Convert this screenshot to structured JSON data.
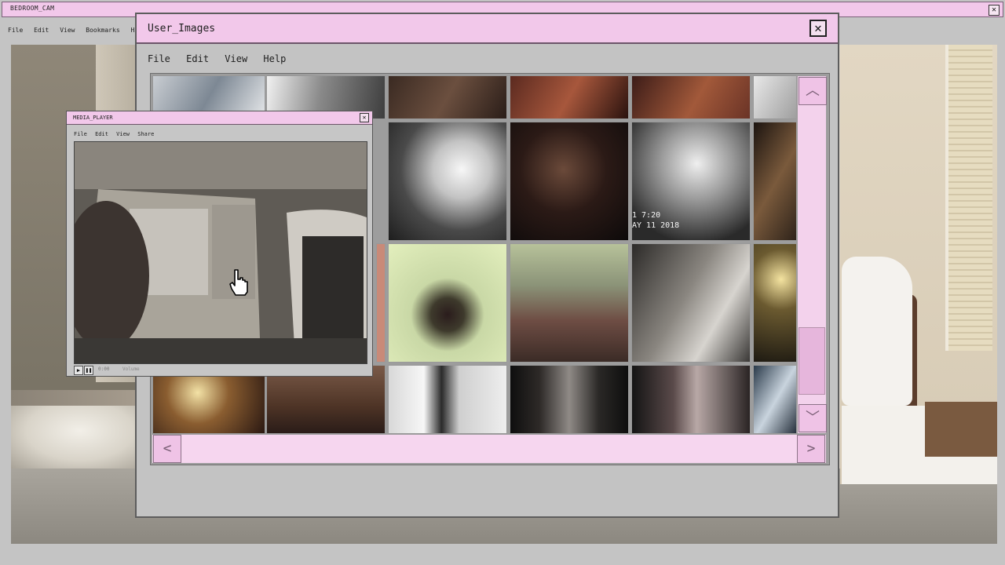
{
  "outer": {
    "title": "BEDROOM_CAM",
    "close_glyph": "✕",
    "menu": [
      "File",
      "Edit",
      "View",
      "Bookmarks",
      "Histor"
    ]
  },
  "user_images": {
    "title": "User_Images",
    "close_glyph": "✕",
    "menu": [
      "File",
      "Edit",
      "View",
      "Help"
    ],
    "scroll": {
      "up_glyph": "︿",
      "down_glyph": "﹀",
      "left_glyph": "<",
      "right_glyph": ">"
    },
    "thumb_stamp": {
      "time": "1 7:20",
      "date": "AY 11 2018"
    }
  },
  "media_player": {
    "title": "MEDIA_PLAYER",
    "close_glyph": "✕",
    "menu": [
      "File",
      "Edit",
      "View",
      "Share"
    ],
    "play_glyph": "▶",
    "pause_glyph": "❚❚",
    "time": "0:00",
    "volume_label": "Volume"
  },
  "icons": {
    "cursor": "hand-pointer-icon"
  },
  "colors": {
    "accent": "#f2c8ea",
    "scroll": "#efc3e6",
    "chrome": "#c3c3c3"
  }
}
